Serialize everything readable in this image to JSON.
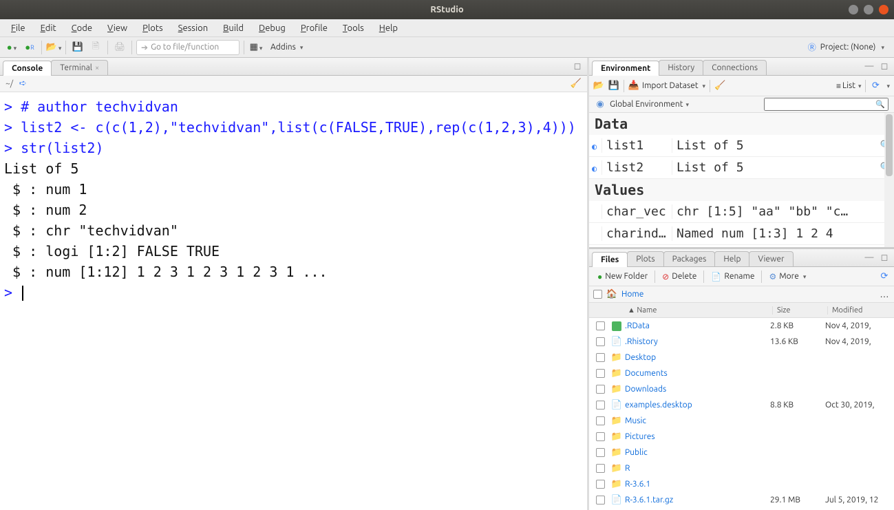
{
  "titlebar": {
    "title": "RStudio"
  },
  "menus": [
    "File",
    "Edit",
    "Code",
    "View",
    "Plots",
    "Session",
    "Build",
    "Debug",
    "Profile",
    "Tools",
    "Help"
  ],
  "toolbar": {
    "goto_placeholder": "Go to file/function",
    "addins_label": "Addins",
    "project_label": "Project: (None)"
  },
  "console": {
    "tab_console": "Console",
    "tab_terminal": "Terminal",
    "path": "~/",
    "lines": [
      {
        "type": "in",
        "prompt": ">",
        "text": " # author techvidvan"
      },
      {
        "type": "in",
        "prompt": ">",
        "text": " list2 <- c(c(1,2),\"techvidvan\",list(c(FALSE,TRUE),rep(c(1,2,3),4)))"
      },
      {
        "type": "in",
        "prompt": ">",
        "text": " str(list2)"
      },
      {
        "type": "out",
        "text": "List of 5"
      },
      {
        "type": "out",
        "text": " $ : num 1"
      },
      {
        "type": "out",
        "text": " $ : num 2"
      },
      {
        "type": "out",
        "text": " $ : chr \"techvidvan\""
      },
      {
        "type": "out",
        "text": " $ : logi [1:2] FALSE TRUE"
      },
      {
        "type": "out",
        "text": " $ : num [1:12] 1 2 3 1 2 3 1 2 3 1 ..."
      },
      {
        "type": "prompt",
        "prompt": ">",
        "text": " "
      }
    ]
  },
  "env": {
    "tabs": [
      "Environment",
      "History",
      "Connections"
    ],
    "import_label": "Import Dataset",
    "list_label": "List",
    "scope_label": "Global Environment",
    "sections": {
      "data_label": "Data",
      "data": [
        {
          "name": "list1",
          "value": "List of 5"
        },
        {
          "name": "list2",
          "value": "List of 5"
        }
      ],
      "values_label": "Values",
      "values": [
        {
          "name": "char_vec",
          "value": "chr [1:5] \"aa\" \"bb\" \"c…"
        },
        {
          "name": "charind…",
          "value": "Named num [1:3] 1 2 4"
        }
      ]
    }
  },
  "files": {
    "tabs": [
      "Files",
      "Plots",
      "Packages",
      "Help",
      "Viewer"
    ],
    "toolbar": {
      "new_folder": "New Folder",
      "delete": "Delete",
      "rename": "Rename",
      "more": "More"
    },
    "breadcrumb_home": "Home",
    "header": {
      "name": "Name",
      "size": "Size",
      "modified": "Modified"
    },
    "rows": [
      {
        "icon": "rdata",
        "name": ".RData",
        "size": "2.8 KB",
        "modified": "Nov 4, 2019,"
      },
      {
        "icon": "file",
        "name": ".Rhistory",
        "size": "13.6 KB",
        "modified": "Nov 4, 2019,"
      },
      {
        "icon": "folder",
        "name": "Desktop",
        "size": "",
        "modified": ""
      },
      {
        "icon": "folder",
        "name": "Documents",
        "size": "",
        "modified": ""
      },
      {
        "icon": "folder",
        "name": "Downloads",
        "size": "",
        "modified": ""
      },
      {
        "icon": "file",
        "name": "examples.desktop",
        "size": "8.8 KB",
        "modified": "Oct 30, 2019,"
      },
      {
        "icon": "folder",
        "name": "Music",
        "size": "",
        "modified": ""
      },
      {
        "icon": "folder",
        "name": "Pictures",
        "size": "",
        "modified": ""
      },
      {
        "icon": "folder",
        "name": "Public",
        "size": "",
        "modified": ""
      },
      {
        "icon": "folder",
        "name": "R",
        "size": "",
        "modified": ""
      },
      {
        "icon": "folder",
        "name": "R-3.6.1",
        "size": "",
        "modified": ""
      },
      {
        "icon": "file",
        "name": "R-3.6.1.tar.gz",
        "size": "29.1 MB",
        "modified": "Jul 5, 2019, 12"
      }
    ]
  }
}
